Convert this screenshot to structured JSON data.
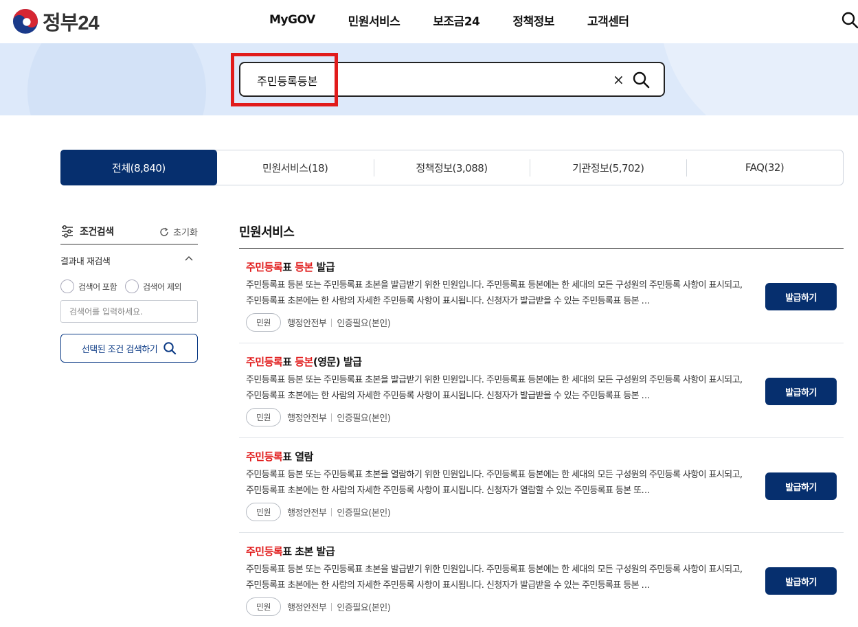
{
  "header": {
    "logo_text": "정부24",
    "nav": [
      "MyGOV",
      "민원서비스",
      "보조금24",
      "정책정보",
      "고객센터"
    ]
  },
  "search": {
    "value": "주민등록등본",
    "clear_label": "×"
  },
  "tabs": [
    {
      "label": "전체(8,840)",
      "active": true
    },
    {
      "label": "민원서비스(18)",
      "active": false
    },
    {
      "label": "정책정보(3,088)",
      "active": false
    },
    {
      "label": "기관정보(5,702)",
      "active": false
    },
    {
      "label": "FAQ(32)",
      "active": false
    }
  ],
  "sidebar": {
    "title": "조건검색",
    "reset_label": "초기화",
    "subtitle": "결과내 재검색",
    "radio_include": "검색어 포함",
    "radio_exclude": "검색어 제외",
    "input_placeholder": "검색어를 입력하세요.",
    "search_button": "선택된 조건 검색하기"
  },
  "results": {
    "section_title": "민원서비스",
    "items": [
      {
        "title_parts": [
          {
            "text": "주민등록",
            "highlight": true
          },
          {
            "text": "표 ",
            "highlight": false
          },
          {
            "text": "등본",
            "highlight": true
          },
          {
            "text": " 발급",
            "highlight": false
          }
        ],
        "description": "주민등록표 등본 또는 주민등록표 초본을 발급받기 위한 민원입니다. 주민등록표 등본에는 한 세대의 모든 구성원의 주민등록 사항이 표시되고, 주민등록표 초본에는 한 사람의 자세한 주민등록 사항이 표시됩니다. 신청자가 발급받을 수 있는 주민등록표 등본 …",
        "badge": "민원",
        "agency": "행정안전부",
        "auth": "인증필요(본인)",
        "button": "발급하기"
      },
      {
        "title_parts": [
          {
            "text": "주민등록",
            "highlight": true
          },
          {
            "text": "표 ",
            "highlight": false
          },
          {
            "text": "등본",
            "highlight": true
          },
          {
            "text": "(영문) 발급",
            "highlight": false
          }
        ],
        "description": "주민등록표 등본 또는 주민등록표 초본을 발급받기 위한 민원입니다. 주민등록표 등본에는 한 세대의 모든 구성원의 주민등록 사항이 표시되고, 주민등록표 초본에는 한 사람의 자세한 주민등록 사항이 표시됩니다. 신청자가 발급받을 수 있는 주민등록표 등본 …",
        "badge": "민원",
        "agency": "행정안전부",
        "auth": "인증필요(본인)",
        "button": "발급하기"
      },
      {
        "title_parts": [
          {
            "text": "주민등록",
            "highlight": true
          },
          {
            "text": "표 열람",
            "highlight": false
          }
        ],
        "description": "주민등록표 등본 또는 주민등록표 초본을 열람하기 위한 민원입니다. 주민등록표 등본에는 한 세대의 모든 구성원의 주민등록 사항이 표시되고, 주민등록표 초본에는 한 사람의 자세한 주민등록 사항이 표시됩니다. 신청자가 열람할 수 있는 주민등록표 등본 또…",
        "badge": "민원",
        "agency": "행정안전부",
        "auth": "인증필요(본인)",
        "button": "발급하기"
      },
      {
        "title_parts": [
          {
            "text": "주민등록",
            "highlight": true
          },
          {
            "text": "표 초본 발급",
            "highlight": false
          }
        ],
        "description": "주민등록표 등본 또는 주민등록표 초본을 발급받기 위한 민원입니다. 주민등록표 등본에는 한 세대의 모든 구성원의 주민등록 사항이 표시되고, 주민등록표 초본에는 한 사람의 자세한 주민등록 사항이 표시됩니다. 신청자가 발급받을 수 있는 주민등록표 등본 …",
        "badge": "민원",
        "agency": "행정안전부",
        "auth": "인증필요(본인)",
        "button": "발급하기"
      }
    ]
  },
  "colors": {
    "primary": "#062f6e",
    "highlight": "#e11b1b",
    "hero_bg": "#dde9fa"
  }
}
